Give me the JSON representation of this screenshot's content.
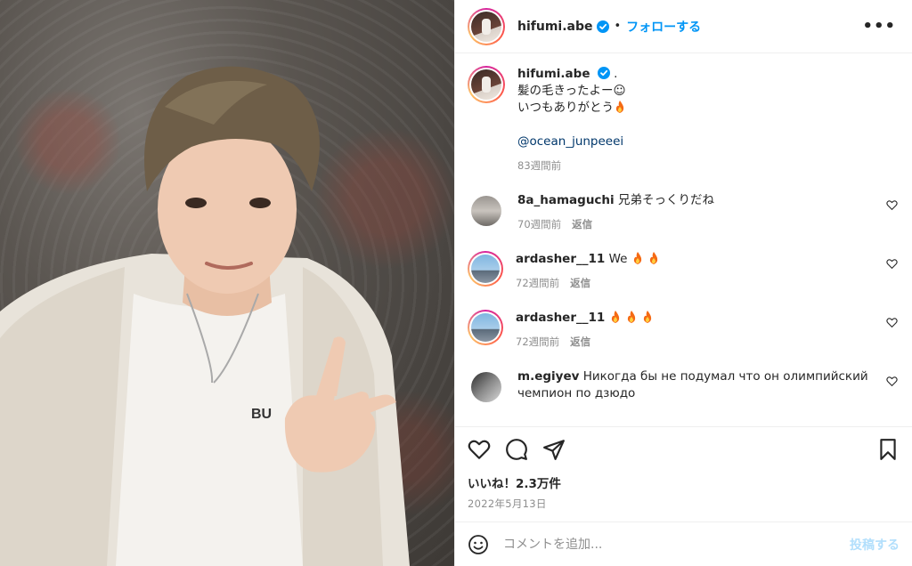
{
  "header": {
    "username": "hifumi.abe",
    "separator": "•",
    "follow_label": "フォローする",
    "more_label": "•••"
  },
  "caption": {
    "username": "hifumi.abe",
    "suffix": ".",
    "line1": "髪の毛きったよー☺︎",
    "line2": "いつもありがとう",
    "mention": "@ocean_junpeeei",
    "time": "83週間前"
  },
  "comments": [
    {
      "username": "8a_hamaguchi",
      "text": "兄弟そっくりだね",
      "time": "70週間前",
      "reply": "返信",
      "fires": 0
    },
    {
      "username": "ardasher__11",
      "text": "We",
      "time": "72週間前",
      "reply": "返信",
      "fires": 2
    },
    {
      "username": "ardasher__11",
      "text": "",
      "time": "72週間前",
      "reply": "返信",
      "fires": 3
    },
    {
      "username": "m.egiyev",
      "text": "Никогда бы не подумал что он олимпийский чемпион по дзюдо",
      "time": "",
      "reply": "",
      "fires": 0
    }
  ],
  "likes_label": "いいね！2.3万件",
  "date_label": "2022年5月13日",
  "add_comment": {
    "placeholder": "コメントを追加...",
    "post_label": "投稿する"
  },
  "colors": {
    "accent": "#0095f6",
    "muted": "#8e8e8e",
    "post_disabled": "#b2dffc",
    "mention": "#00376b"
  },
  "icons": [
    "verified-badge-icon",
    "more-icon",
    "heart-icon",
    "comment-icon",
    "share-icon",
    "bookmark-icon",
    "emoji-icon",
    "fire-icon"
  ]
}
